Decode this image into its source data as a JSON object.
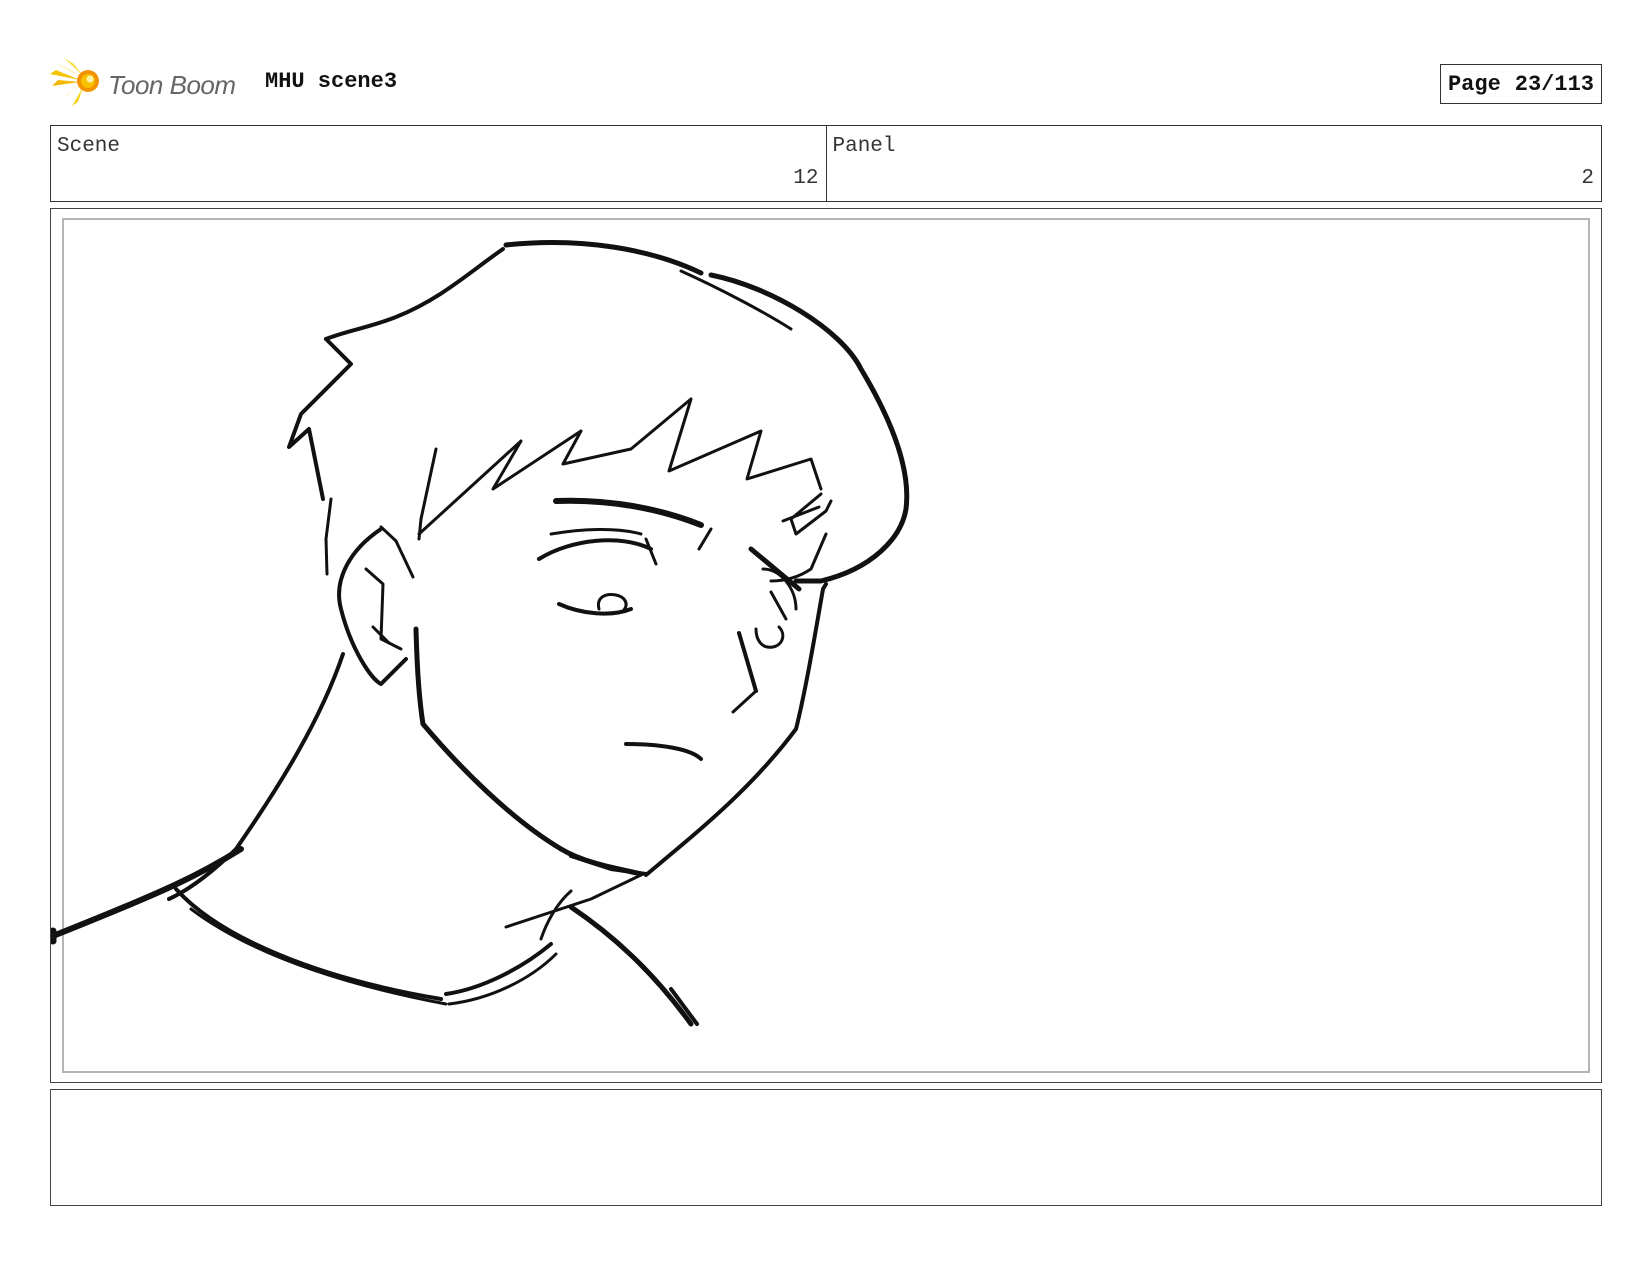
{
  "header": {
    "logo_text": "Toon Boom",
    "project_title": "MHU scene3",
    "page_label": "Page",
    "page_value": "23/113"
  },
  "scene": {
    "label": "Scene",
    "value": "12"
  },
  "panel": {
    "label": "Panel",
    "value": "2"
  },
  "icons": {
    "logo": "starburst-logo-icon"
  },
  "colors": {
    "logo_yellow": "#f5c400",
    "logo_orange": "#f39200",
    "ink": "#111111"
  },
  "notes": {
    "text": ""
  }
}
